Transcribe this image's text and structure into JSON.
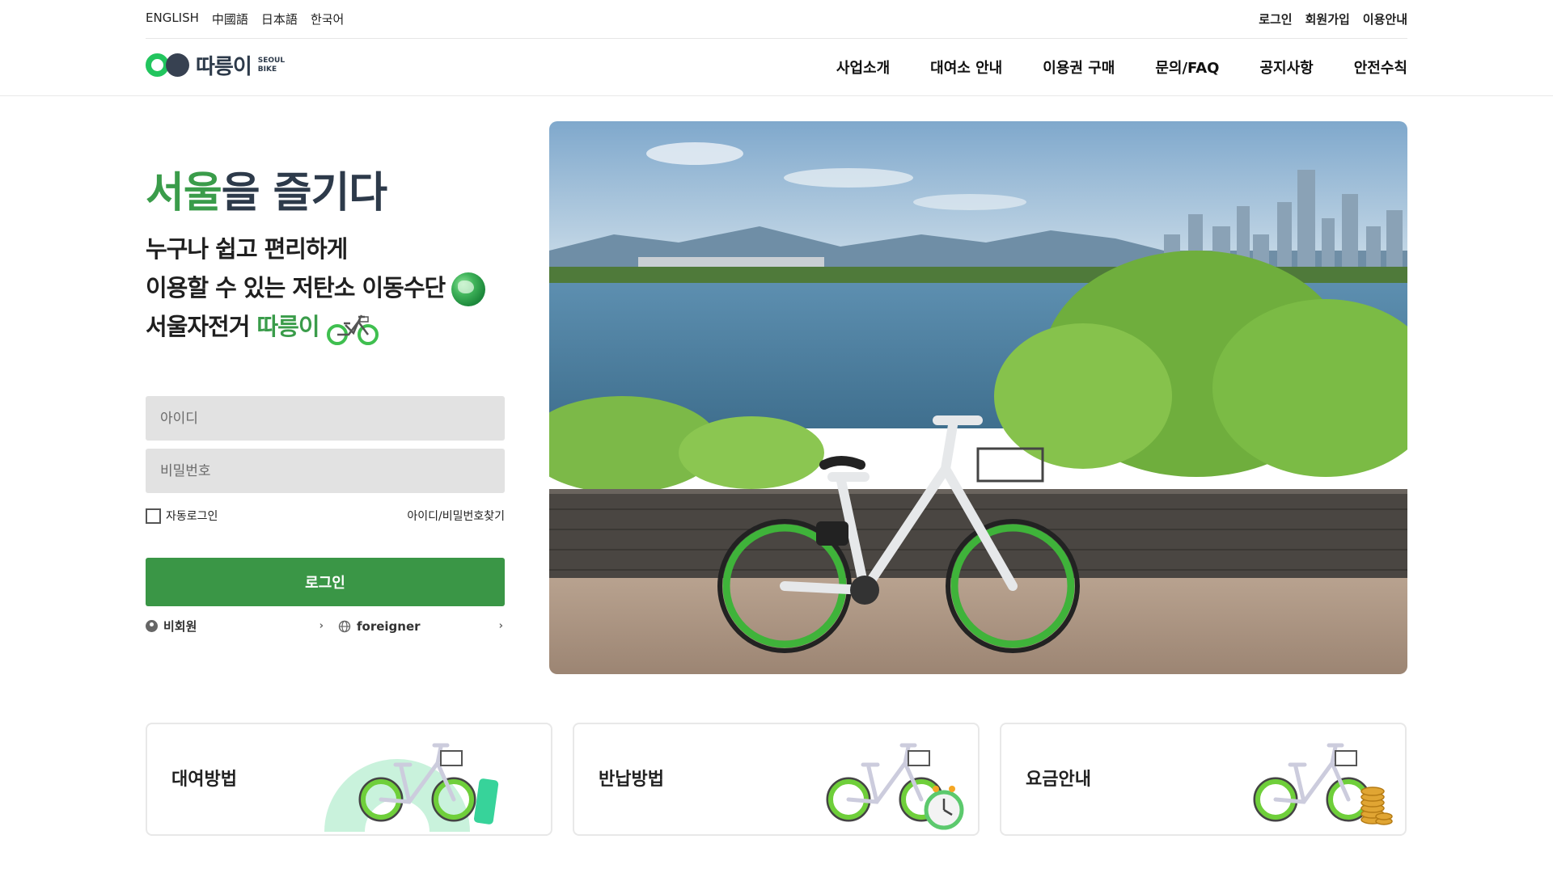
{
  "topbar": {
    "languages": [
      "ENGLISH",
      "中國語",
      "日本語",
      "한국어"
    ],
    "util_links": [
      "로그인",
      "회원가입",
      "이용안내"
    ]
  },
  "header": {
    "logo_text": "따릉이",
    "logo_sub_1": "SEOUL",
    "logo_sub_2": "BIKE",
    "nav": [
      "사업소개",
      "대여소 안내",
      "이용권 구매",
      "문의/FAQ",
      "공지사항",
      "안전수칙"
    ]
  },
  "hero": {
    "title_green": "서울",
    "title_rest": "을 즐기다",
    "line1": "누구나 쉽고 편리하게",
    "line2": "이용할 수 있는 저탄소 이동수단",
    "line3_prefix": "서울자전거 ",
    "line3_green": "따릉이"
  },
  "login": {
    "id_placeholder": "아이디",
    "pw_placeholder": "비밀번호",
    "auto_login": "자동로그인",
    "find_account": "아이디/비밀번호찾기",
    "submit": "로그인",
    "guest": "비회원",
    "foreigner": "foreigner"
  },
  "cards": [
    {
      "label": "대여방법"
    },
    {
      "label": "반납방법"
    },
    {
      "label": "요금안내"
    }
  ],
  "colors": {
    "brand_green": "#3a9646",
    "text_dark": "#2d3a4a",
    "field_bg": "#e2e2e2"
  }
}
